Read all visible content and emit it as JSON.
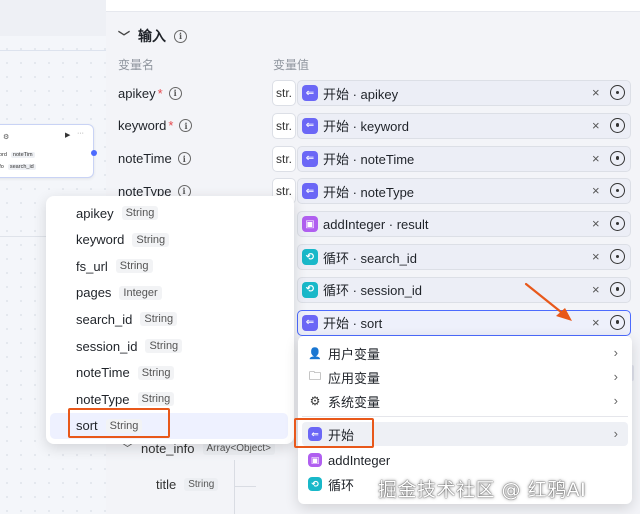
{
  "canvas": {
    "mini_node": {
      "rows": [
        {
          "name": "word",
          "tag": "noteTim"
        },
        {
          "name": "info",
          "tag": "search_id"
        }
      ]
    }
  },
  "input_section": {
    "title": "输入",
    "col_name": "变量名",
    "col_value": "变量值",
    "rows": [
      {
        "label": "apikey",
        "required": true,
        "type_tag": "str.",
        "icon": "start",
        "value": "开始 · apikey"
      },
      {
        "label": "keyword",
        "required": true,
        "type_tag": "str.",
        "icon": "start",
        "value": "开始 · keyword"
      },
      {
        "label": "noteTime",
        "required": false,
        "type_tag": "str.",
        "icon": "start",
        "value": "开始 · noteTime"
      },
      {
        "label": "noteType",
        "required": false,
        "type_tag": "str.",
        "icon": "start",
        "value": "开始 · noteType"
      },
      {
        "label": "",
        "required": false,
        "type_tag": "",
        "icon": "add",
        "value": "addInteger · result"
      },
      {
        "label": "",
        "required": false,
        "type_tag": "",
        "icon": "loop",
        "value": "循环 · search_id"
      },
      {
        "label": "",
        "required": false,
        "type_tag": "",
        "icon": "loop",
        "value": "循环 · session_id"
      },
      {
        "label": "",
        "required": false,
        "type_tag": "",
        "icon": "start",
        "value": "开始 · sort"
      }
    ],
    "clear_symbol": "×"
  },
  "variable_popover": {
    "items": [
      {
        "name": "apikey",
        "type": "String"
      },
      {
        "name": "keyword",
        "type": "String"
      },
      {
        "name": "fs_url",
        "type": "String"
      },
      {
        "name": "pages",
        "type": "Integer"
      },
      {
        "name": "search_id",
        "type": "String"
      },
      {
        "name": "session_id",
        "type": "String"
      },
      {
        "name": "noteTime",
        "type": "String"
      },
      {
        "name": "noteType",
        "type": "String"
      },
      {
        "name": "sort",
        "type": "String",
        "selected": true
      }
    ]
  },
  "tree_behind": {
    "note_info": {
      "name": "note_info",
      "type": "Array<Object>"
    },
    "title": {
      "name": "title",
      "type": "String"
    }
  },
  "dropdown_menu": {
    "items": [
      {
        "label": "用户变量",
        "icon": "user-icon"
      },
      {
        "label": "应用变量",
        "icon": "folder-icon"
      },
      {
        "label": "系统变量",
        "icon": "gear-icon"
      },
      {
        "label": "开始",
        "icon": "start-node-icon",
        "hover": true
      },
      {
        "label": "addInteger",
        "icon": "add-integer-node-icon"
      },
      {
        "label": "循环",
        "icon": "loop-node-icon"
      }
    ]
  },
  "annotation_color": "#e8581a",
  "accent_color": "#4d6bfe",
  "watermark": "掘金技术社区 @ 红鸦AI"
}
